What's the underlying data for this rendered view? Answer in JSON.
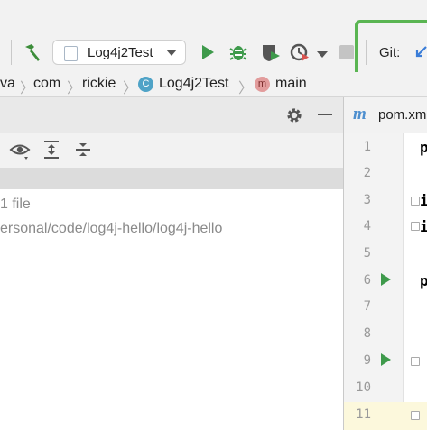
{
  "toolbar": {
    "run_config": "Log4j2Test",
    "git_label": "Git:",
    "colors": {
      "run": "#3e9a4b",
      "highlight": "#5ab552",
      "hammer": "#3c8d3a"
    }
  },
  "breadcrumb": {
    "items": [
      {
        "label": "va"
      },
      {
        "label": "com"
      },
      {
        "label": "rickie"
      },
      {
        "label": "Log4j2Test",
        "icon": "class-icon",
        "icon_letter": "C"
      },
      {
        "label": "main",
        "icon": "method-icon",
        "icon_letter": "m"
      }
    ]
  },
  "left_panel": {
    "summary": "1 file",
    "path": "ersonal/code/log4j-hello/log4j-hello"
  },
  "editor": {
    "tab_label": "pom.xm",
    "tab_icon_letter": "m",
    "line_numbers": [
      "1",
      "2",
      "3",
      "4",
      "5",
      "6",
      "7",
      "8",
      "9",
      "10",
      "11"
    ],
    "code_chars": [
      "p",
      "i",
      "i",
      "p"
    ]
  }
}
